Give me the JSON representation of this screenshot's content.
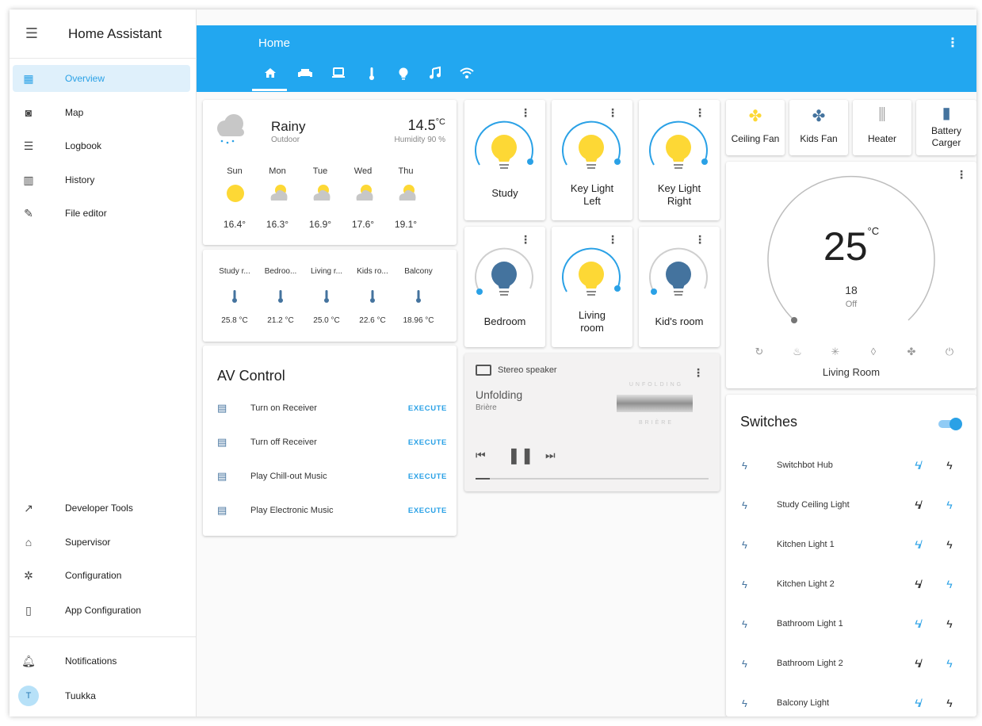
{
  "app": {
    "title": "Home Assistant"
  },
  "sidebar": {
    "items": [
      {
        "label": "Overview",
        "icon": "dashboard-icon"
      },
      {
        "label": "Map",
        "icon": "map-icon"
      },
      {
        "label": "Logbook",
        "icon": "logbook-icon"
      },
      {
        "label": "History",
        "icon": "history-icon"
      },
      {
        "label": "File editor",
        "icon": "wrench-icon"
      }
    ],
    "bottom_items": [
      {
        "label": "Developer Tools",
        "icon": "hammer-icon"
      },
      {
        "label": "Supervisor",
        "icon": "supervisor-icon"
      },
      {
        "label": "Configuration",
        "icon": "gear-icon"
      },
      {
        "label": "App Configuration",
        "icon": "cellphone-cog-icon"
      }
    ],
    "notifications_label": "Notifications",
    "user": {
      "initial": "T",
      "name": "Tuukka"
    }
  },
  "header": {
    "title": "Home",
    "tabs": [
      "home-icon",
      "sofa-icon",
      "laptop-icon",
      "thermometer-icon",
      "lightbulb-icon",
      "music-icon",
      "wifi-icon"
    ],
    "active_tab": 0,
    "accent_color": "#22a7f0"
  },
  "weather": {
    "condition": "Rainy",
    "location": "Outdoor",
    "temperature": "14.5",
    "unit": "°C",
    "humidity": "Humidity 90 %",
    "forecast": [
      {
        "day": "Sun",
        "temp": "16.4°",
        "icon": "sunny"
      },
      {
        "day": "Mon",
        "temp": "16.3°",
        "icon": "partly-cloudy"
      },
      {
        "day": "Tue",
        "temp": "16.9°",
        "icon": "partly-cloudy"
      },
      {
        "day": "Wed",
        "temp": "17.6°",
        "icon": "partly-cloudy"
      },
      {
        "day": "Thu",
        "temp": "19.1°",
        "icon": "partly-cloudy"
      }
    ]
  },
  "sensors": [
    {
      "name": "Study r...",
      "value": "25.8 °C"
    },
    {
      "name": "Bedroo...",
      "value": "21.2 °C"
    },
    {
      "name": "Living r...",
      "value": "25.0 °C"
    },
    {
      "name": "Kids ro...",
      "value": "22.6 °C"
    },
    {
      "name": "Balcony",
      "value": "18.96 °C"
    }
  ],
  "av_control": {
    "title": "AV Control",
    "execute_label": "EXECUTE",
    "scripts": [
      "Turn on Receiver",
      "Turn off Receiver",
      "Play Chill-out Music",
      "Play Electronic Music"
    ]
  },
  "lights": [
    {
      "name_lines": [
        "Study"
      ],
      "on": true
    },
    {
      "name_lines": [
        "Key Light",
        "Left"
      ],
      "on": true
    },
    {
      "name_lines": [
        "Key Light",
        "Right"
      ],
      "on": true
    },
    {
      "name_lines": [
        "Bedroom"
      ],
      "on": false
    },
    {
      "name_lines": [
        "Living",
        "room"
      ],
      "on": true
    },
    {
      "name_lines": [
        "Kid's room"
      ],
      "on": false
    }
  ],
  "media": {
    "device": "Stereo speaker",
    "track": "Unfolding",
    "artist": "Brière",
    "album_art_top": "UNFOLDING",
    "album_art_bottom": "BRIÈRE",
    "progress": 0.06
  },
  "buttons": [
    {
      "name_lines": [
        "Ceiling Fan"
      ],
      "icon": "fan-icon",
      "color": "#fdd835"
    },
    {
      "name_lines": [
        "Kids Fan"
      ],
      "icon": "fan-icon",
      "color": "#44739e"
    },
    {
      "name_lines": [
        "Heater"
      ],
      "icon": "heater-icon",
      "color": "#9e9e9e"
    },
    {
      "name_lines": [
        "Battery",
        "Carger"
      ],
      "icon": "battery-charging-icon",
      "color": "#44739e"
    }
  ],
  "thermostat": {
    "target": "25",
    "unit": "°C",
    "current": "18",
    "state": "Off",
    "name": "Living Room",
    "modes": [
      "auto-icon",
      "fire-icon",
      "snowflake-icon",
      "water-icon",
      "fan-icon",
      "power-icon"
    ]
  },
  "switches": {
    "title": "Switches",
    "master_on": true,
    "items": [
      {
        "name": "Switchbot Hub",
        "on": true
      },
      {
        "name": "Study Ceiling Light",
        "on": false
      },
      {
        "name": "Kitchen Light 1",
        "on": true
      },
      {
        "name": "Kitchen Light 2",
        "on": false
      },
      {
        "name": "Bathroom Light 1",
        "on": true
      },
      {
        "name": "Bathroom Light 2",
        "on": false
      },
      {
        "name": "Balcony Light",
        "on": true
      }
    ]
  }
}
